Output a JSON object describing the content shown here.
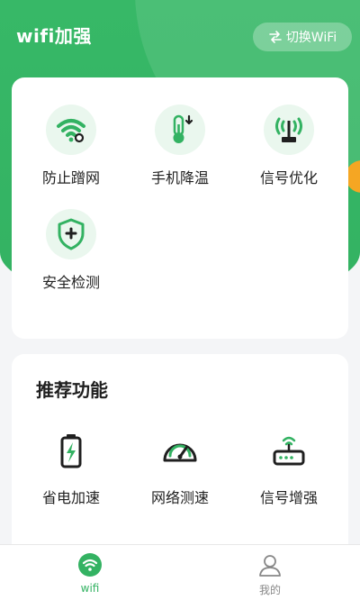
{
  "header": {
    "title": "wifi加强",
    "switch_label": "切换WiFi"
  },
  "tools": [
    {
      "label": "防止蹭网",
      "icon": "wifi-lock-icon"
    },
    {
      "label": "手机降温",
      "icon": "thermometer-icon"
    },
    {
      "label": "信号优化",
      "icon": "signal-tower-icon"
    },
    {
      "label": "安全检测",
      "icon": "shield-plus-icon"
    }
  ],
  "recommend": {
    "title": "推荐功能",
    "items": [
      {
        "label": "省电加速",
        "icon": "battery-bolt-icon"
      },
      {
        "label": "网络测速",
        "icon": "speedometer-icon"
      },
      {
        "label": "信号增强",
        "icon": "router-icon"
      }
    ]
  },
  "tabbar": [
    {
      "label": "wifi",
      "icon": "wifi-icon",
      "active": true
    },
    {
      "label": "我的",
      "icon": "user-icon",
      "active": false
    }
  ],
  "colors": {
    "primary": "#33b262",
    "primary_light": "#eaf7ee",
    "accent": "#f5a623",
    "background": "#f4f5f7"
  }
}
